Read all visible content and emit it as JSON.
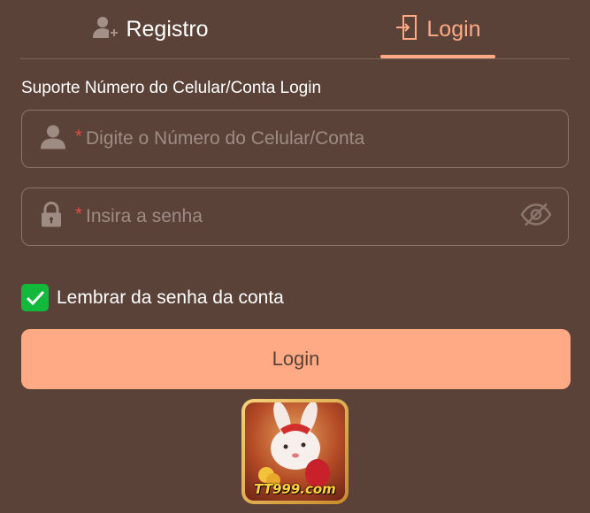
{
  "tabs": {
    "registro": {
      "label": "Registro",
      "icon": "user-add-icon"
    },
    "login": {
      "label": "Login",
      "icon": "login-door-icon",
      "active": true
    }
  },
  "form": {
    "support_label": "Suporte Número do Celular/Conta Login",
    "account": {
      "required_mark": "*",
      "placeholder": "Digite o Número do Celular/Conta",
      "value": "",
      "icon": "user-icon"
    },
    "password": {
      "required_mark": "*",
      "placeholder": "Insira a senha",
      "value": "",
      "icon": "lock-icon",
      "toggle_icon": "eye-slash-icon"
    },
    "remember": {
      "label": "Lembrar da senha da conta",
      "checked": true
    },
    "submit_label": "Login"
  },
  "logo": {
    "text": "TT999.com"
  },
  "colors": {
    "background": "#5a4238",
    "accent": "#ffaa85",
    "check": "#12b93a",
    "required": "#f04646"
  }
}
